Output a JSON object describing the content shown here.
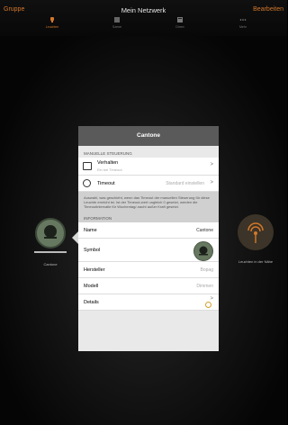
{
  "nav": {
    "left": "Gruppe",
    "title": "Mein Netzwerk",
    "right": "Bearbeiten",
    "tabs": [
      {
        "label": "Leuchten",
        "icon": "lamp-icon",
        "active": true
      },
      {
        "label": "Szene",
        "icon": "scene-icon",
        "active": false
      },
      {
        "label": "Dimm",
        "icon": "dimmer-icon",
        "active": false
      },
      {
        "label": "Mehr",
        "icon": "more-icon",
        "active": false
      }
    ]
  },
  "nodes": {
    "left_label": "Cantone",
    "right_label": "Leuchten in der Nähe"
  },
  "popover": {
    "title": "Cantone",
    "section_manual": "MANUELLE STEUERUNG",
    "behavior_label": "Verhalten",
    "behavior_value": "Ein bei Timeout",
    "timeout_label": "Timeout",
    "timeout_value": "Standard einstellen",
    "explanation": "Auswahl, was geschieht, wenn das Timeout der manuellen Steuerung für diese Leuchte erreicht ist. Ist der Timeout-wert ungleich 0 gesetzt, werden die Timeoutintervalle für Wochentag/-nacht außer Kraft gesetzt.",
    "section_info": "INFORMATION",
    "name_label": "Name",
    "name_value": "Cantone",
    "symbol_label": "Symbol",
    "manufacturer_label": "Hersteller",
    "manufacturer_value": "Bopag",
    "model_label": "Modell",
    "model_value": "Dimmen",
    "details_label": "Details",
    "chevron": ">"
  },
  "colors": {
    "accent": "#d4782a",
    "node_green": "#66785f"
  }
}
